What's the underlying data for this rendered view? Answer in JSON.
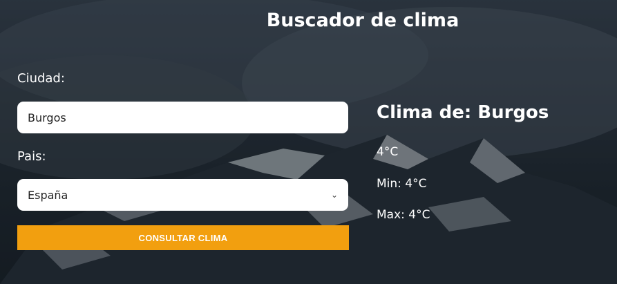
{
  "page": {
    "title": "Buscador de clima"
  },
  "form": {
    "city_label": "Ciudad:",
    "city_value": "Burgos",
    "country_label": "Pais:",
    "country_value": "España",
    "submit_label": "CONSULTAR CLIMA"
  },
  "result": {
    "title": "Clima de: Burgos",
    "temp": "4°C",
    "min": "Min: 4°C",
    "max": "Max: 4°C"
  },
  "colors": {
    "accent": "#f29f0f"
  },
  "icons": {
    "select": "chevron-down-icon"
  }
}
